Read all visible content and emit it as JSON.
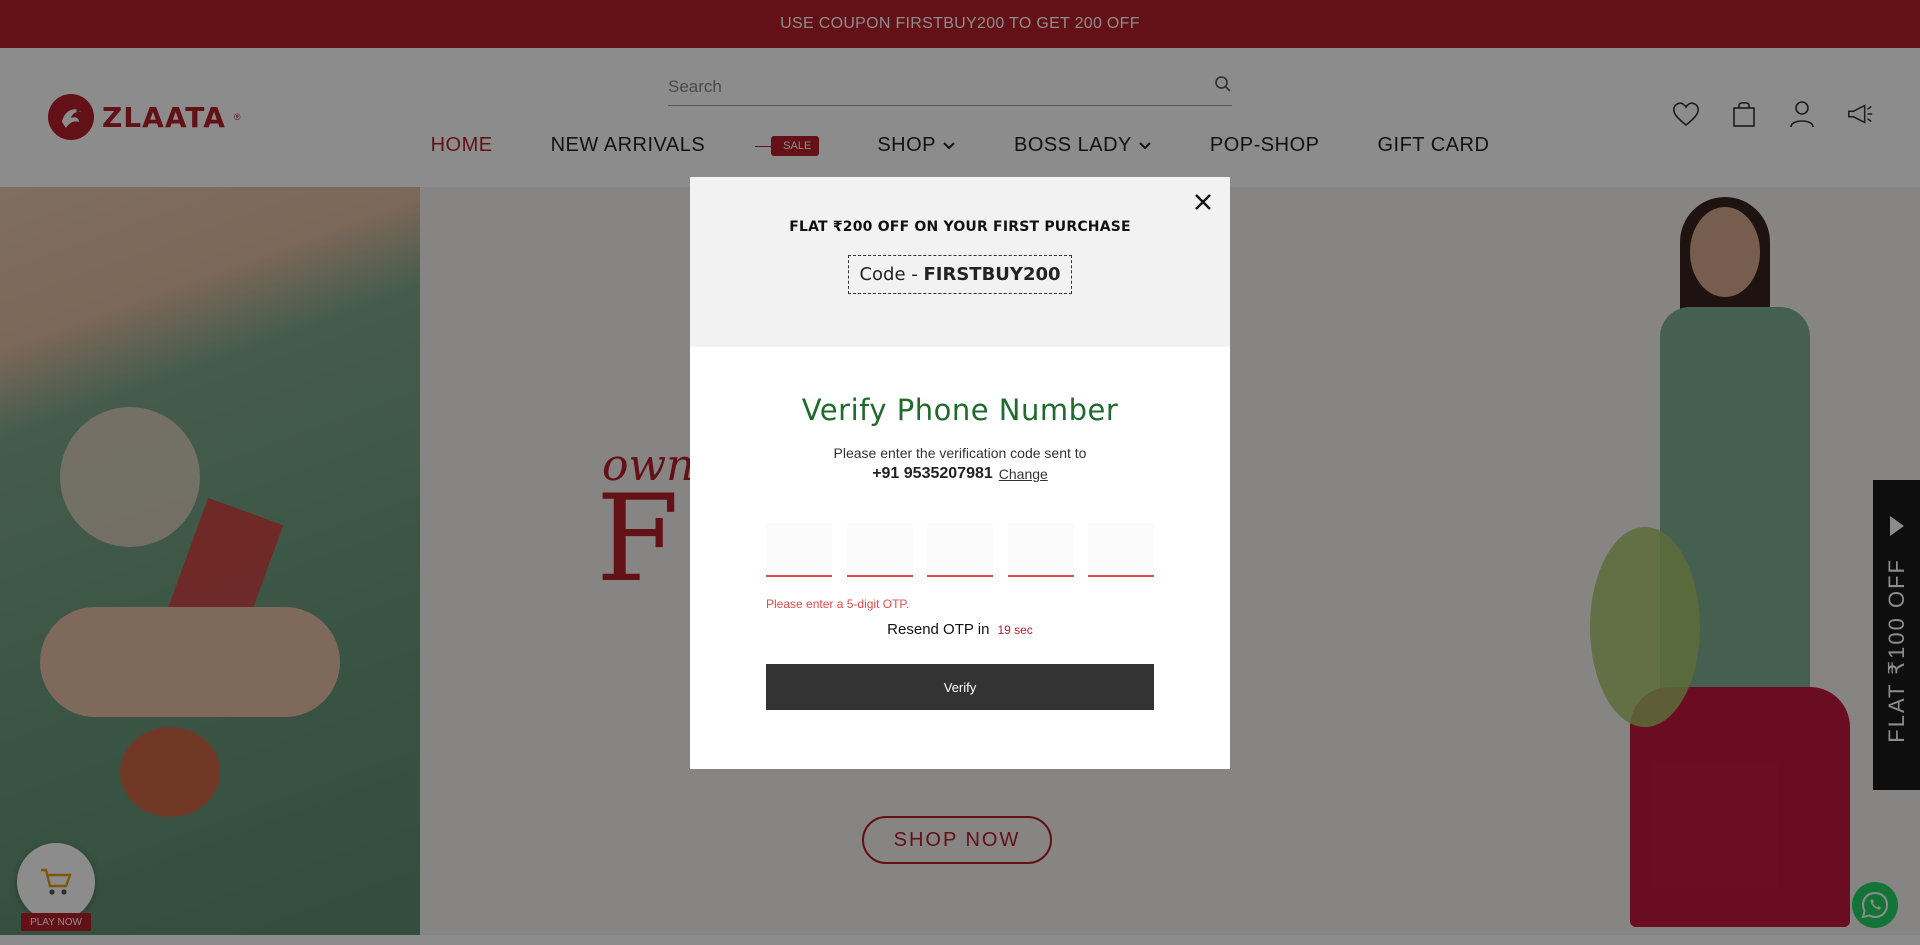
{
  "announcement": {
    "text": "USE COUPON FIRSTBUY200 TO GET 200 OFF"
  },
  "header": {
    "logo_text": "ZLAATA",
    "logo_reg": "®",
    "search": {
      "placeholder": "Search",
      "value": ""
    },
    "nav": [
      {
        "label": "HOME",
        "active": true
      },
      {
        "label": "NEW ARRIVALS"
      },
      {
        "label": "SALE",
        "badge": true
      },
      {
        "label": "SHOP",
        "dropdown": true
      },
      {
        "label": "BOSS LADY",
        "dropdown": true
      },
      {
        "label": "POP-SHOP"
      },
      {
        "label": "GIFT CARD"
      }
    ],
    "icons": [
      "heart-icon",
      "bag-icon",
      "user-icon",
      "megaphone-icon"
    ]
  },
  "hero": {
    "text_small": "own",
    "text_big": "F",
    "cta": "SHOP NOW",
    "side_offer": "FLAT ₹100 OFF",
    "play_label": "PLAY NOW"
  },
  "modal": {
    "promo_title": "FLAT ₹200 OFF ON YOUR FIRST PURCHASE",
    "code_prefix": "Code - ",
    "code_value": "FIRSTBUY200",
    "title": "Verify Phone Number",
    "subtitle": "Please enter the verification code sent to",
    "phone": "+91 9535207981",
    "change_label": "Change",
    "otp_boxes": [
      "",
      "",
      "",
      "",
      ""
    ],
    "error": "Please enter a 5-digit OTP.",
    "resend_label": "Resend OTP in",
    "resend_timer": "19 sec",
    "verify_label": "Verify"
  },
  "colors": {
    "brand": "#b41e2a",
    "title_green": "#1f6b2e",
    "button_dark": "#333333",
    "error": "#e44a4a"
  }
}
